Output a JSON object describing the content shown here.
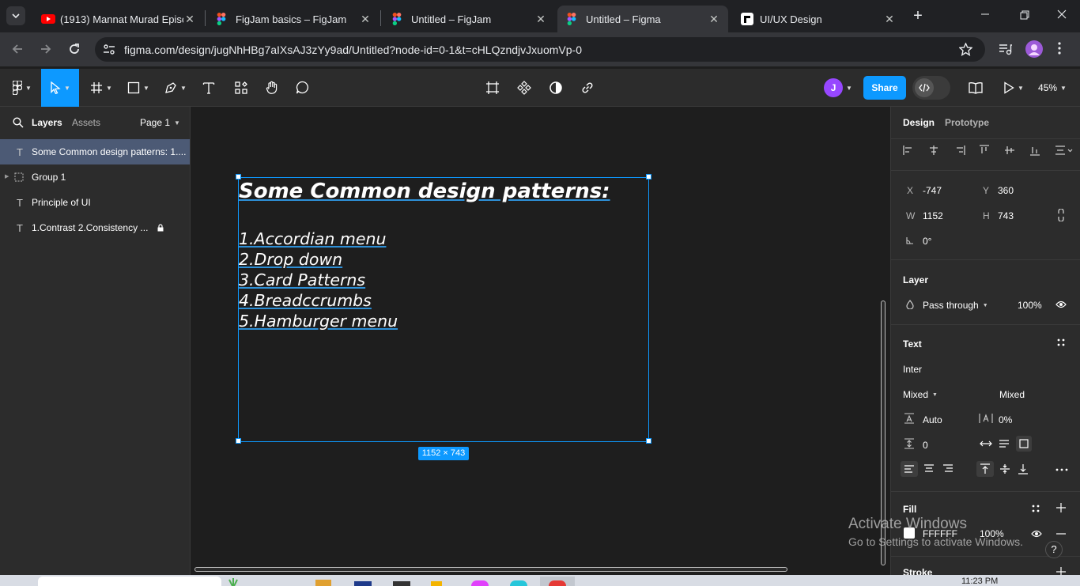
{
  "browser": {
    "tabs": [
      {
        "title": "(1913) Mannat Murad Episod",
        "icon": "youtube-icon"
      },
      {
        "title": "FigJam basics – FigJam",
        "icon": "figma-icon"
      },
      {
        "title": "Untitled – FigJam",
        "icon": "figma-icon"
      },
      {
        "title": "Untitled – Figma",
        "icon": "figma-icon",
        "active": true
      },
      {
        "title": "UI/UX Design",
        "icon": "site-icon"
      }
    ],
    "url": "figma.com/design/jugNhHBg7aIXsAJ3zYy9ad/Untitled?node-id=0-1&t=cHLQzndjvJxuomVp-0"
  },
  "toolbar": {
    "avatar_initial": "J",
    "share_label": "Share",
    "zoom": "45%"
  },
  "left_panel": {
    "tabs": {
      "layers": "Layers",
      "assets": "Assets"
    },
    "page": "Page 1",
    "layers": [
      {
        "name": "Some Common design patterns: 1....",
        "icon": "text-icon",
        "selected": true
      },
      {
        "name": "Group 1",
        "icon": "group-icon"
      },
      {
        "name": "Principle of UI",
        "icon": "text-icon"
      },
      {
        "name": "1.Contrast 2.Consistency ...",
        "icon": "text-icon",
        "locked": true
      }
    ]
  },
  "canvas": {
    "heading": "Some Common design patterns:",
    "items": [
      "1.Accordian menu",
      "2.Drop down",
      "3.Card Patterns",
      "4.Breadccrumbs",
      "5.Hamburger menu"
    ],
    "size_badge": "1152 × 743"
  },
  "right_panel": {
    "tabs": {
      "design": "Design",
      "prototype": "Prototype"
    },
    "x_label": "X",
    "x": "-747",
    "y_label": "Y",
    "y": "360",
    "w_label": "W",
    "w": "1152",
    "h_label": "H",
    "h": "743",
    "rotation": "0°",
    "layer": {
      "title": "Layer",
      "blend": "Pass through",
      "opacity": "100%"
    },
    "text": {
      "title": "Text",
      "font": "Inter",
      "weight": "Mixed",
      "size": "Mixed",
      "line_height": "Auto",
      "letter_spacing": "0%",
      "paragraph_spacing": "0"
    },
    "fill": {
      "title": "Fill",
      "hex": "FFFFFF",
      "opacity": "100%"
    },
    "stroke": {
      "title": "Stroke"
    }
  },
  "watermark": {
    "line1": "Activate Windows",
    "line2": "Go to Settings to activate Windows."
  },
  "taskbar": {
    "time": "11:23 PM"
  },
  "colors": {
    "accent": "#0d99ff",
    "avatar": "#9747ff",
    "canvas": "#1e1e1e",
    "panel": "#2c2c2c"
  }
}
